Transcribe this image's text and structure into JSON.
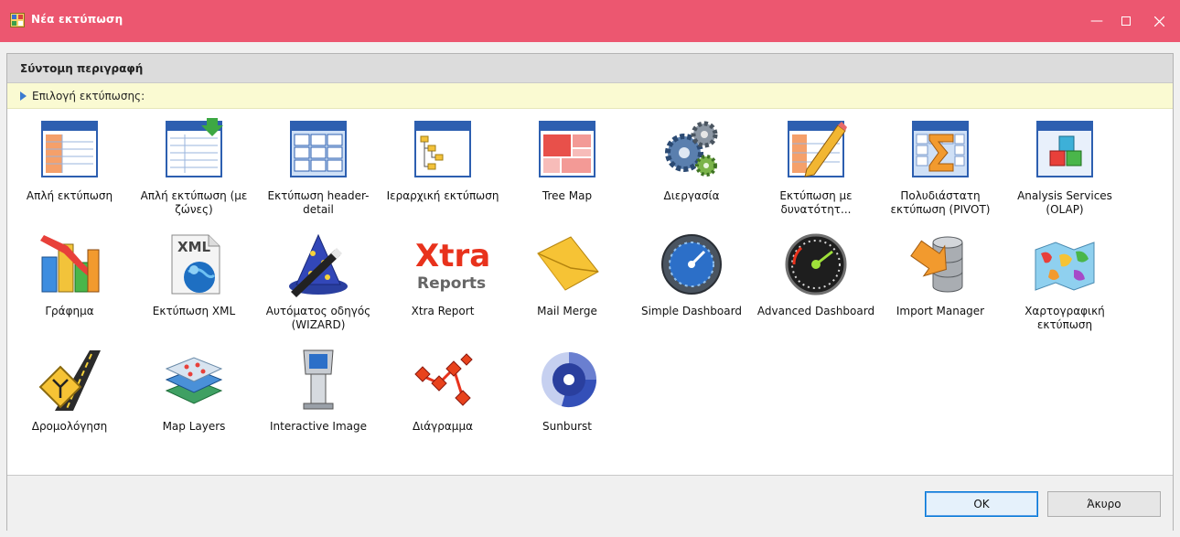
{
  "window": {
    "title": "Νέα εκτύπωση",
    "accent": "#ec5770"
  },
  "header": {
    "section_title": "Σύντομη περιγραφή",
    "subheading": "Επιλογή εκτύπωσης:"
  },
  "items": [
    {
      "label": "Απλή εκτύπωση",
      "icon": "simple-print-icon"
    },
    {
      "label": "Απλή εκτύπωση (με ζώνες)",
      "icon": "banded-print-icon"
    },
    {
      "label": "Εκτύπωση header-detail",
      "icon": "header-detail-icon"
    },
    {
      "label": "Ιεραρχική εκτύπωση",
      "icon": "hierarchical-print-icon"
    },
    {
      "label": "Tree Map",
      "icon": "tree-map-icon"
    },
    {
      "label": "Διεργασία",
      "icon": "gears-icon"
    },
    {
      "label": "Εκτύπωση με δυνατότητ...",
      "icon": "editable-print-icon"
    },
    {
      "label": "Πολυδιάστατη εκτύπωση (PIVOT)",
      "icon": "pivot-icon"
    },
    {
      "label": "Analysis Services (OLAP)",
      "icon": "olap-cubes-icon"
    },
    {
      "label": "Γράφημα",
      "icon": "chart-icon"
    },
    {
      "label": "Εκτύπωση XML",
      "icon": "xml-icon"
    },
    {
      "label": "Αυτόματος οδηγός (WIZARD)",
      "icon": "wizard-hat-icon"
    },
    {
      "label": "Xtra Report",
      "icon": "xtra-reports-icon"
    },
    {
      "label": "Mail Merge",
      "icon": "envelope-icon"
    },
    {
      "label": "Simple Dashboard",
      "icon": "simple-gauge-icon"
    },
    {
      "label": "Advanced Dashboard",
      "icon": "speedometer-icon"
    },
    {
      "label": "Import Manager",
      "icon": "database-import-icon"
    },
    {
      "label": "Χαρτογραφική εκτύπωση",
      "icon": "world-map-icon"
    },
    {
      "label": "Δρομολόγηση",
      "icon": "routing-road-icon"
    },
    {
      "label": "Map Layers",
      "icon": "map-layers-icon"
    },
    {
      "label": "Interactive Image",
      "icon": "kiosk-icon"
    },
    {
      "label": "Διάγραμμα",
      "icon": "diagram-icon"
    },
    {
      "label": "Sunburst",
      "icon": "sunburst-icon"
    }
  ],
  "xtra_logo": {
    "top": "Xtra",
    "bottom": "Reports"
  },
  "xml_badge": "XML",
  "footer": {
    "ok_label": "OK",
    "cancel_label": "Άκυρο"
  }
}
